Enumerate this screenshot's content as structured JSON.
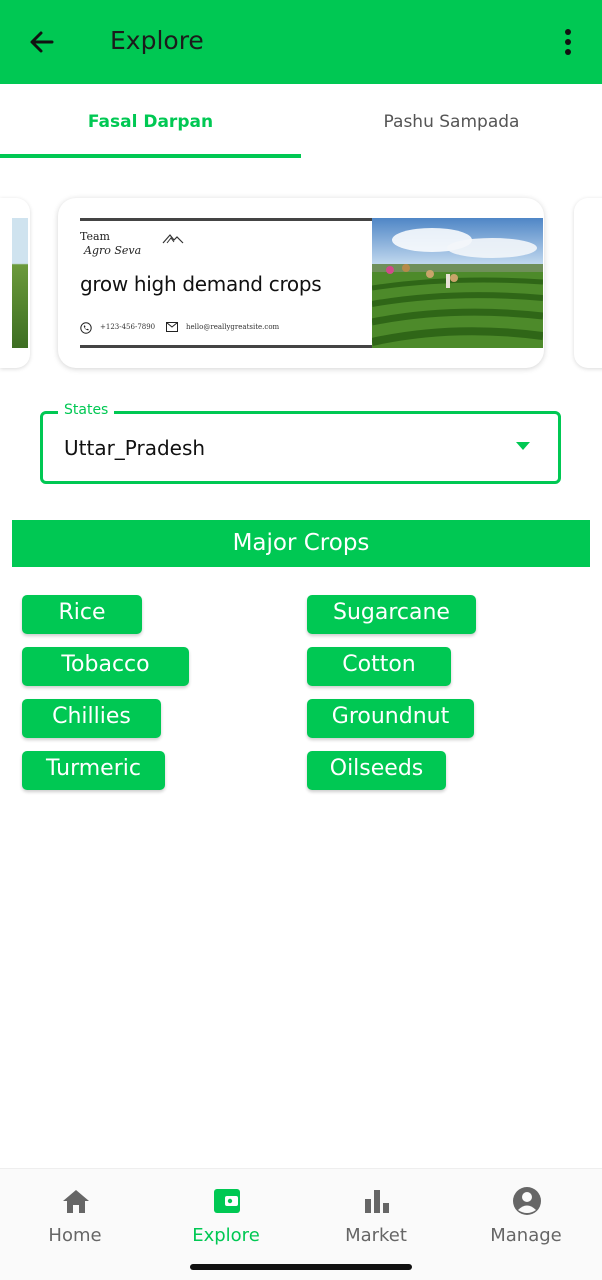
{
  "appbar": {
    "title": "Explore",
    "back_icon": "arrow-left-icon",
    "menu_icon": "more-vertical-icon",
    "color": "#00c853"
  },
  "tabs": [
    {
      "label": "Fasal Darpan",
      "active": true
    },
    {
      "label": "Pashu Sampada",
      "active": false
    }
  ],
  "banner": {
    "brand_line1": "Team",
    "brand_line2": "Agro Seva",
    "headline": "grow high demand crops",
    "phone": "+123-456-7890",
    "email": "hello@reallygreatsite.com"
  },
  "states_dropdown": {
    "label": "States",
    "value": "Uttar_Pradesh"
  },
  "major_crops": {
    "title": "Major Crops",
    "items": [
      "Rice",
      "Sugarcane",
      "Tobacco",
      "Cotton",
      "Chillies",
      "Groundnut",
      "Turmeric",
      "Oilseeds"
    ]
  },
  "bottom_nav": [
    {
      "label": "Home",
      "icon": "home-icon",
      "active": false
    },
    {
      "label": "Explore",
      "icon": "wallet-icon",
      "active": true
    },
    {
      "label": "Market",
      "icon": "bar-chart-icon",
      "active": false
    },
    {
      "label": "Manage",
      "icon": "account-circle-icon",
      "active": false
    }
  ]
}
